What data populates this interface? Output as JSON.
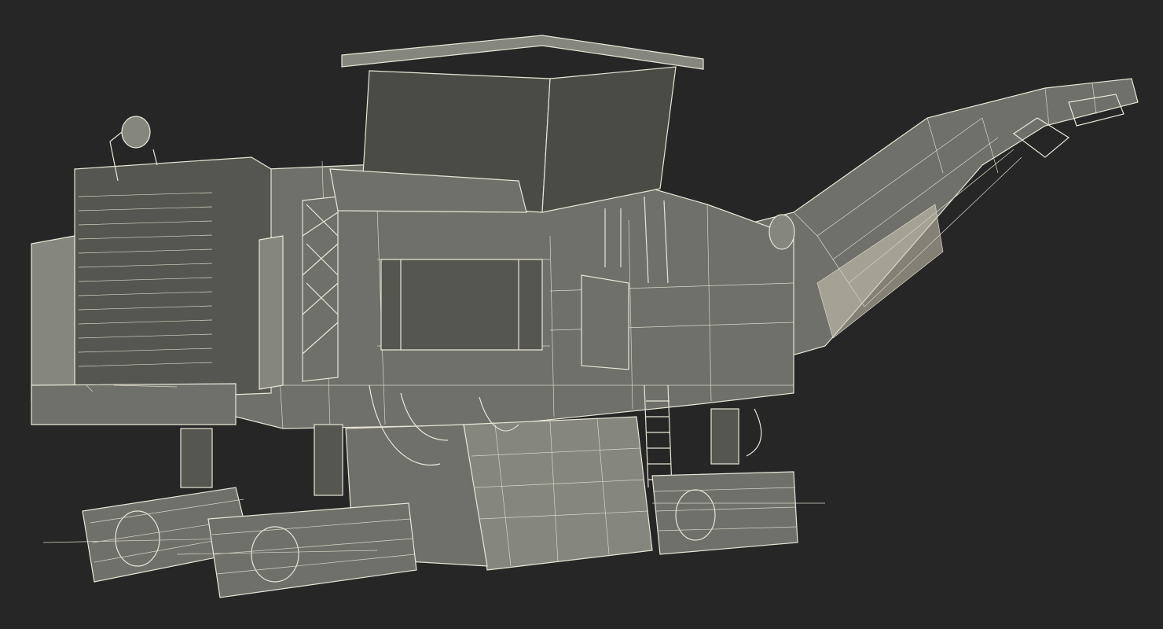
{
  "scene": {
    "subject_icon": "cold-milling-machine-wireframe-icon",
    "colors": {
      "background": "#262626",
      "body": "#6f706a",
      "body_dark": "#55564f",
      "body_light": "#85867e",
      "wireframe": "#e9e6d6"
    }
  }
}
